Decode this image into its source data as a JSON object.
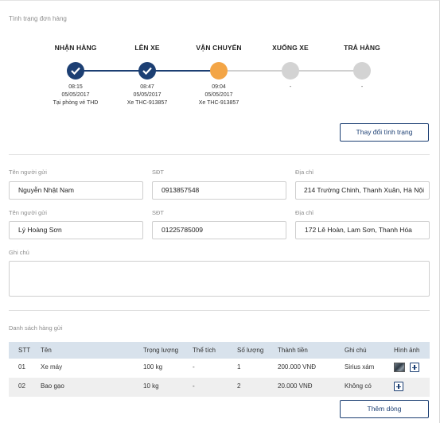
{
  "status_section": {
    "label": "Tình trạng đơn hàng",
    "steps": [
      {
        "title": "NHẬN HÀNG",
        "state": "done",
        "time": "08:15",
        "date": "05/05/2017",
        "note": "Tại phòng vé THD"
      },
      {
        "title": "LÊN XE",
        "state": "done",
        "time": "08:47",
        "date": "05/05/2017",
        "note": "Xe THC-913857"
      },
      {
        "title": "VẬN CHUYỂN",
        "state": "current",
        "time": "09:04",
        "date": "05/05/2017",
        "note": "Xe THC-913857"
      },
      {
        "title": "XUỐNG XE",
        "state": "pending",
        "time": "-",
        "date": "",
        "note": ""
      },
      {
        "title": "TRẢ HÀNG",
        "state": "pending",
        "time": "-",
        "date": "",
        "note": ""
      }
    ],
    "change_status_label": "Thay đổi tình trạng"
  },
  "sender": {
    "name_label": "Tên người gửi",
    "name_value": "Nguyễn Nhật Nam",
    "phone_label": "SĐT",
    "phone_value": "0913857548",
    "address_label": "Địa chỉ",
    "address_value": "214 Trường Chinh, Thanh Xuân, Hà Nội"
  },
  "receiver": {
    "name_label": "Tên người gửi",
    "name_value": "Lý Hoàng Sơn",
    "phone_label": "SĐT",
    "phone_value": "01225785009",
    "address_label": "Địa chỉ",
    "address_value": "172 Lê Hoàn, Lam Sơn, Thanh Hóa"
  },
  "note": {
    "label": "Ghi chú",
    "value": ""
  },
  "goods": {
    "label": "Danh sách hàng gửi",
    "headers": {
      "stt": "STT",
      "name": "Tên",
      "weight": "Trọng lượng",
      "volume": "Thể tích",
      "quantity": "Số lượng",
      "amount": "Thành tiền",
      "note": "Ghi chú",
      "image": "Hình ảnh"
    },
    "rows": [
      {
        "stt": "01",
        "name": "Xe máy",
        "weight": "100 kg",
        "volume": "-",
        "quantity": "1",
        "amount": "200.000 VNĐ",
        "note": "Sirius xám",
        "has_image": true
      },
      {
        "stt": "02",
        "name": "Bao gạo",
        "weight": "10 kg",
        "volume": "-",
        "quantity": "2",
        "amount": "20.000 VNĐ",
        "note": "Không có",
        "has_image": false
      }
    ],
    "add_row_label": "Thêm dòng"
  },
  "colors": {
    "primary": "#1c3f73",
    "current": "#f3a546",
    "pending": "#d3d3d3",
    "table_header": "#d8e2ec"
  }
}
